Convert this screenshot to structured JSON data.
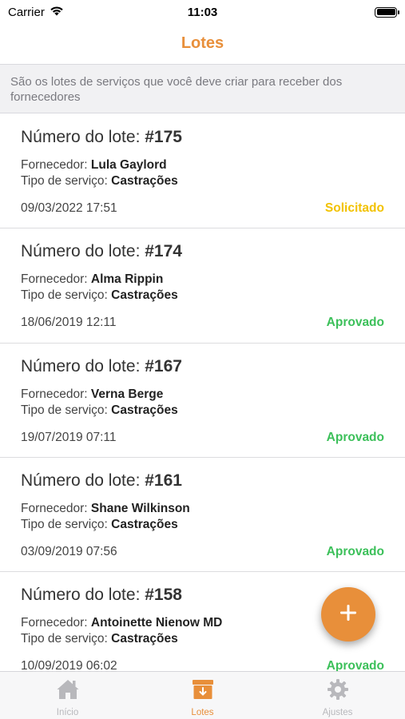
{
  "status_bar": {
    "carrier": "Carrier",
    "time": "11:03"
  },
  "nav": {
    "title": "Lotes"
  },
  "banner": {
    "text": "São os lotes de serviços que você deve criar para receber dos fornecedores"
  },
  "labels": {
    "lot_number": "Número do lote: ",
    "supplier": "Fornecedor: ",
    "service_type": "Tipo de serviço: "
  },
  "lots": [
    {
      "number": "#175",
      "supplier": "Lula Gaylord",
      "service": "Castrações",
      "date": "09/03/2022 17:51",
      "status": "Solicitado",
      "status_color": "#f2c200"
    },
    {
      "number": "#174",
      "supplier": "Alma Rippin",
      "service": "Castrações",
      "date": "18/06/2019 12:11",
      "status": "Aprovado",
      "status_color": "#3cc05a"
    },
    {
      "number": "#167",
      "supplier": "Verna Berge",
      "service": "Castrações",
      "date": "19/07/2019 07:11",
      "status": "Aprovado",
      "status_color": "#3cc05a"
    },
    {
      "number": "#161",
      "supplier": "Shane Wilkinson",
      "service": "Castrações",
      "date": "03/09/2019 07:56",
      "status": "Aprovado",
      "status_color": "#3cc05a"
    },
    {
      "number": "#158",
      "supplier": "Antoinette Nienow MD",
      "service": "Castrações",
      "date": "10/09/2019 06:02",
      "status": "Aprovado",
      "status_color": "#3cc05a"
    }
  ],
  "tabs": [
    {
      "label": "Início",
      "icon": "home-icon",
      "active": false
    },
    {
      "label": "Lotes",
      "icon": "archive-box-icon",
      "active": true
    },
    {
      "label": "Ajustes",
      "icon": "gear-icon",
      "active": false
    }
  ],
  "colors": {
    "accent": "#e88f3a",
    "approved": "#3cc05a",
    "requested": "#f2c200",
    "inactive_tab": "#b8b8bc"
  },
  "fab": {
    "icon": "plus-icon"
  }
}
